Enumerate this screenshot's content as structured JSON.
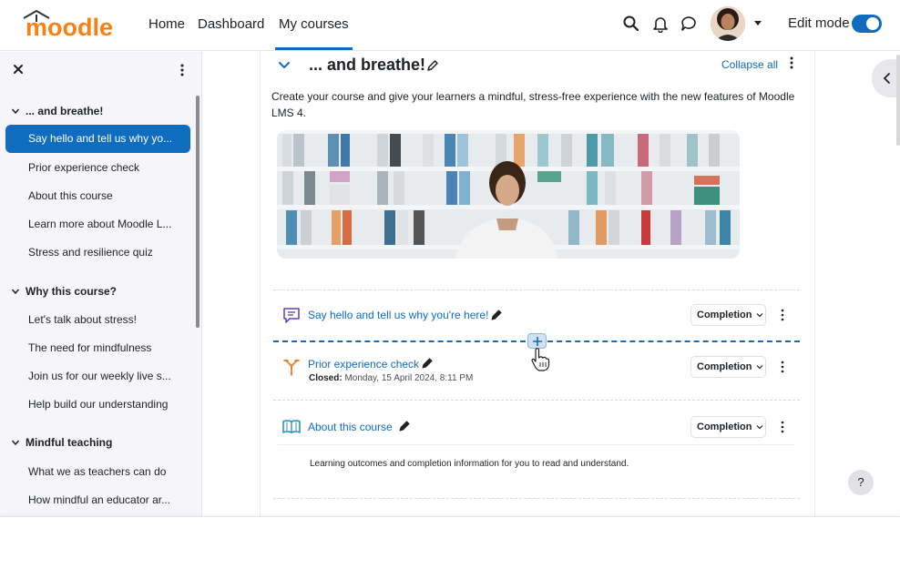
{
  "navbar": {
    "logo_text": "moodle",
    "links": [
      "Home",
      "Dashboard",
      "My courses"
    ],
    "edit_mode_label": "Edit mode",
    "edit_mode_on": true,
    "icons": [
      "search-icon",
      "bell-icon",
      "chat-icon",
      "user-avatar",
      "chevron-down-icon"
    ]
  },
  "sidebar": {
    "sections": [
      {
        "title": "... and breathe!",
        "items": [
          "Say hello and tell us why yo...",
          "Prior experience check",
          "About this course",
          "Learn more about Moodle L...",
          "Stress and resilience quiz"
        ],
        "active_index": 0
      },
      {
        "title": "Why this course?",
        "items": [
          "Let's talk about stress!",
          "The need for mindfulness",
          "Join us for our weekly live s...",
          "Help build our understanding"
        ]
      },
      {
        "title": "Mindful teaching",
        "items": [
          "What we as teachers can do",
          "How mindful an educator ar..."
        ]
      }
    ]
  },
  "main": {
    "section_title": "... and breathe!",
    "collapse_all": "Collapse all",
    "summary": "Create your course and give your learners a mindful, stress-free experience with the new features of Moodle LMS 4.",
    "activities": [
      {
        "name": "Say hello and tell us why you're here!",
        "type": "forum",
        "completion": "Completion"
      },
      {
        "name": "Prior experience check",
        "type": "choice",
        "closed_label": "Closed:",
        "closed_value": "Monday, 15 April 2024, 8:11 PM",
        "completion": "Completion"
      },
      {
        "name": "About this course",
        "type": "book",
        "completion": "Completion",
        "description": "Learning outcomes and completion information for you to read and understand."
      }
    ],
    "help": "?"
  },
  "colors": {
    "primary": "#0f6cbf",
    "logo_orange": "#f98012",
    "forum_purple": "#5b3fb8",
    "choice_orange": "#e67e22",
    "book_teal": "#1a8fb0"
  }
}
